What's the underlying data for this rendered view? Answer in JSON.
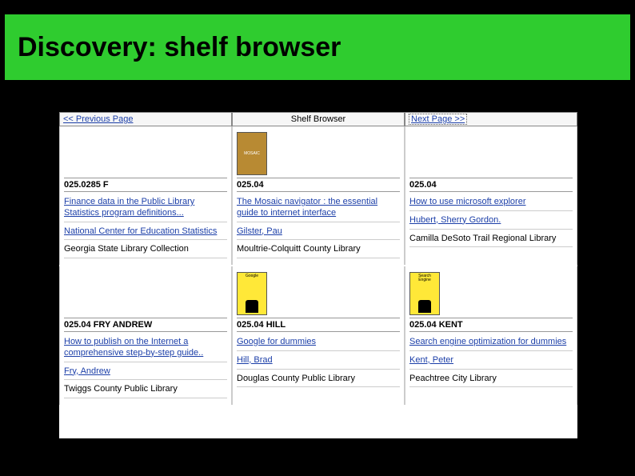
{
  "slide": {
    "title": "Discovery: shelf browser"
  },
  "nav": {
    "prev": "<< Previous Page",
    "center": "Shelf Browser",
    "next": "Next Page >>"
  },
  "row1": [
    {
      "cover": null,
      "callno": "025.0285 F",
      "title": "Finance data in the Public Library Statistics program definitions...",
      "author": "National Center for Education Statistics",
      "library": "Georgia State Library Collection"
    },
    {
      "cover": "mosaic",
      "callno": "025.04",
      "title": "The Mosaic navigator : the essential guide to internet interface",
      "author": "Gilster, Pau",
      "library": "Moultrie-Colquitt County Library"
    },
    {
      "cover": null,
      "callno": "025.04",
      "title": "How to use microsoft explorer",
      "author": "Hubert, Sherry Gordon.",
      "library": "Camilla DeSoto Trail Regional Library"
    }
  ],
  "row2": [
    {
      "cover": null,
      "callno": "025.04 FRY ANDREW",
      "title": "How to publish on the Internet a comprehensive step-by-step guide..",
      "author": "Fry, Andrew",
      "library": "Twiggs County Public Library"
    },
    {
      "cover": "dummies-google",
      "callno": "025.04 HILL",
      "title": "Google for dummies",
      "author": "Hill, Brad",
      "library": "Douglas County Public Library"
    },
    {
      "cover": "dummies-seo",
      "callno": "025.04 KENT",
      "title": "Search engine optimization for dummies",
      "author": "Kent, Peter",
      "library": "Peachtree City Library"
    }
  ],
  "covers": {
    "mosaic_label": "MOSAIC",
    "google_label": "Google",
    "seo_label": "Search Engine"
  }
}
